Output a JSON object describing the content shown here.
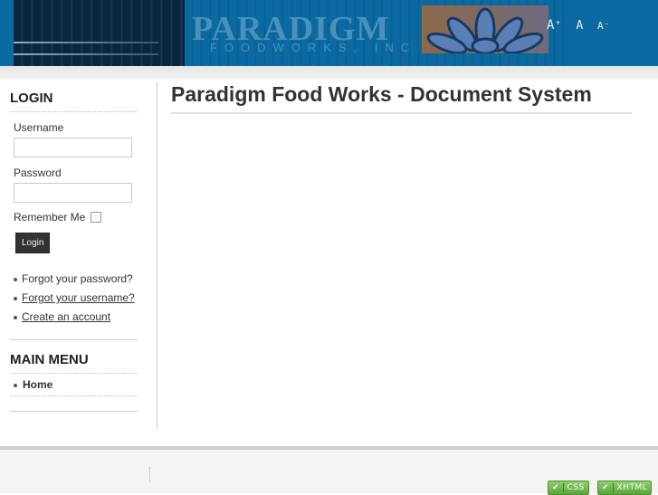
{
  "header": {
    "logo_main": "PARADIGM",
    "logo_sub": "FOODWORKS, INC",
    "font_size_controls": [
      {
        "label": "A⁺",
        "name": "increase-font"
      },
      {
        "label": "A",
        "name": "reset-font"
      },
      {
        "label": "A⁻",
        "name": "decrease-font"
      }
    ]
  },
  "login": {
    "title": "LOGIN",
    "username_label": "Username",
    "username_value": "",
    "password_label": "Password",
    "password_value": "",
    "remember_label": "Remember Me",
    "remember_checked": false,
    "button_label": "Login",
    "links": [
      "Forgot your password?",
      "Forgot your username?",
      "Create an account"
    ]
  },
  "main_menu": {
    "title": "MAIN MENU",
    "items": [
      "Home"
    ]
  },
  "main": {
    "title": "Paradigm Food Works - Document System"
  },
  "footer": {
    "badges": [
      {
        "check": "✔",
        "label": "CSS"
      },
      {
        "check": "✔",
        "label": "XHTML"
      }
    ]
  },
  "colors": {
    "header_blue": "#0a6aa1",
    "header_dark": "#0a2740",
    "badge_green": "#5aa63c"
  }
}
